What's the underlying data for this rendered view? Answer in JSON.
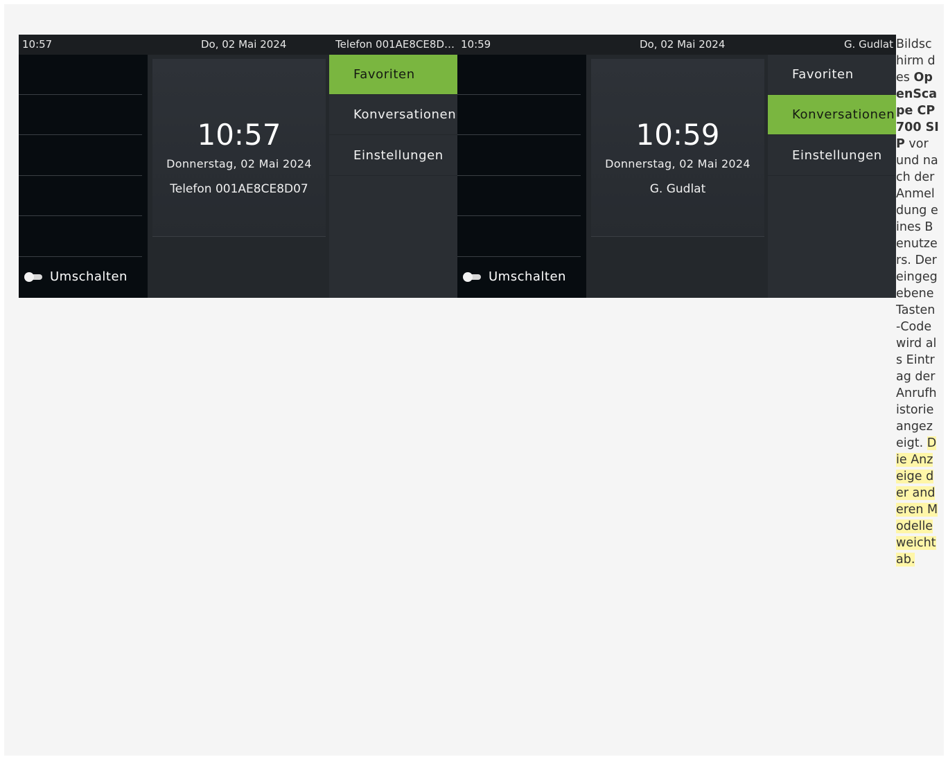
{
  "screens": [
    {
      "statusbar": {
        "time": "10:57",
        "date": "Do, 02 Mai 2024",
        "user": "Telefon 001AE8CE8D…"
      },
      "clock": {
        "time": "10:57",
        "long_date": "Donnerstag, 02 Mai 2024",
        "identity": "Telefon 001AE8CE8D07"
      },
      "toggle_label": "Umschalten",
      "menu": [
        {
          "label": "Favoriten",
          "active": true
        },
        {
          "label": "Konversationen",
          "active": false
        },
        {
          "label": "Einstellungen",
          "active": false
        }
      ]
    },
    {
      "statusbar": {
        "time": "10:59",
        "date": "Do, 02 Mai 2024",
        "user": "G. Gudlat"
      },
      "clock": {
        "time": "10:59",
        "long_date": "Donnerstag, 02 Mai 2024",
        "identity": "G. Gudlat"
      },
      "toggle_label": "Umschalten",
      "menu": [
        {
          "label": "Favoriten",
          "active": false
        },
        {
          "label": "Konversationen",
          "active": true
        },
        {
          "label": "Einstellungen",
          "active": false
        }
      ]
    }
  ],
  "caption": {
    "part1": "Bildschirm des ",
    "product": "OpenScape CP700 SIP",
    "part2": " vor und nach der Anmeldung eines Benutzers. Der eingegebene Tasten-Code wird als Eintrag der Anrufhistorie angezeigt. ",
    "note": "Die Anzeige der anderen Modelle weicht ab."
  },
  "colors": {
    "accent": "#7ab640",
    "screen_bg": "#24282c",
    "softkey_bg": "#070c10",
    "highlight": "#fff6a8"
  }
}
